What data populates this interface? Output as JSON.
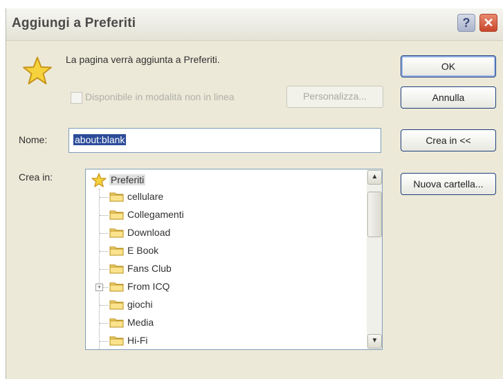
{
  "dialog": {
    "title": "Aggiungi a Preferiti",
    "message": "La pagina verrà aggiunta a Preferiti.",
    "offline_checkbox_label": "Disponibile in modalità non in linea",
    "personalize_label": "Personalizza...",
    "name_label": "Nome:",
    "name_value": "about:blank",
    "create_in_label": "Crea in:",
    "ok_label": "OK",
    "cancel_label": "Annulla",
    "create_in_button_label": "Crea in <<",
    "new_folder_label": "Nuova cartella...",
    "help_glyph": "?",
    "close_glyph": "✕"
  },
  "tree": {
    "root": "Preferiti",
    "folders": [
      "cellulare",
      "Collegamenti",
      "Download",
      "E Book",
      "Fans Club",
      "From ICQ",
      "giochi",
      "Media",
      "Hi-Fi"
    ],
    "expandable": "From ICQ"
  },
  "colors": {
    "selection": "#2c4c9a",
    "button_border": "#1c3c7c",
    "folder": "#f2d06c",
    "star": "#f6d23c"
  }
}
